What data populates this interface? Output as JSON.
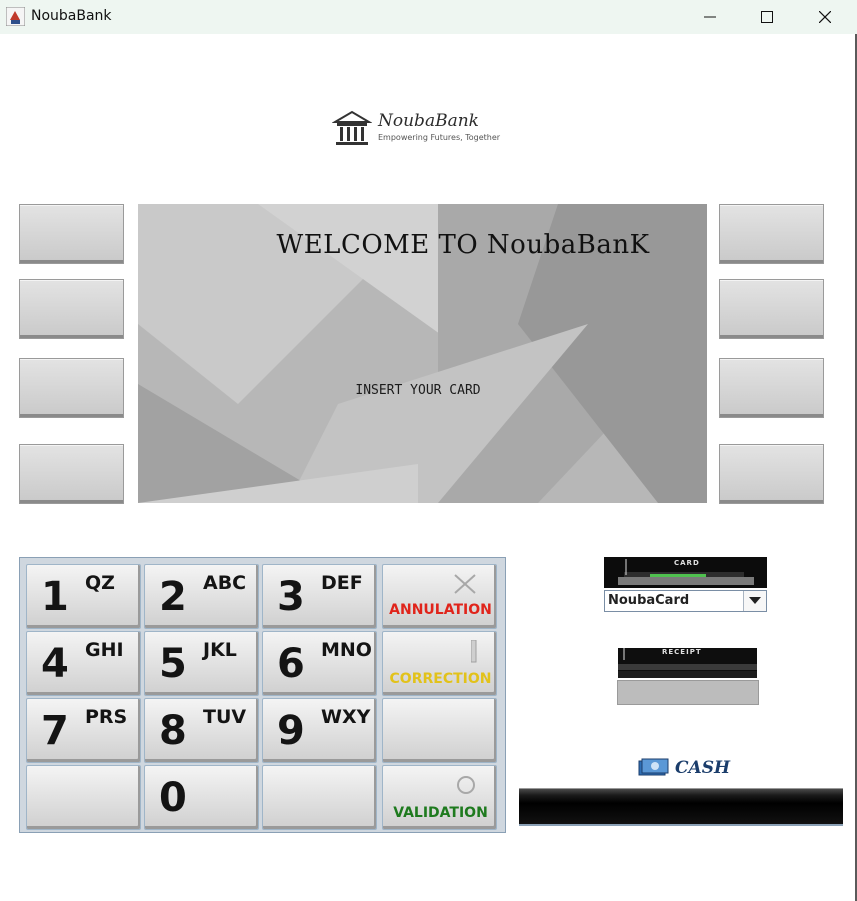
{
  "window": {
    "title": "NoubaBank",
    "app_icon": "java-cup-icon",
    "controls": [
      "minimize-icon",
      "maximize-icon",
      "close-icon"
    ]
  },
  "logo": {
    "brand": "NoubaBank",
    "tagline": "Empowering Futures, Together",
    "icon": "bank-building-icon"
  },
  "screen": {
    "welcome": "WELCOME TO NoubaBanK",
    "prompt": "INSERT YOUR CARD"
  },
  "side_buttons": {
    "left_count": 4,
    "right_count": 4
  },
  "keypad": {
    "keys": [
      {
        "digit": "1",
        "letters": "QZ"
      },
      {
        "digit": "2",
        "letters": "ABC"
      },
      {
        "digit": "3",
        "letters": "DEF"
      },
      {
        "function": "ANNULATION",
        "color": "#e0241b",
        "icon": "cancel-x-icon"
      },
      {
        "digit": "4",
        "letters": "GHI"
      },
      {
        "digit": "5",
        "letters": "JKL"
      },
      {
        "digit": "6",
        "letters": "MNO"
      },
      {
        "function": "CORRECTION",
        "color": "#e2c21a",
        "icon": "bar-icon"
      },
      {
        "digit": "7",
        "letters": "PRS"
      },
      {
        "digit": "8",
        "letters": "TUV"
      },
      {
        "digit": "9",
        "letters": "WXY"
      },
      {
        "function": "",
        "icon": ""
      },
      {
        "digit": "",
        "letters": ""
      },
      {
        "digit": "0",
        "letters": ""
      },
      {
        "digit": "",
        "letters": ""
      },
      {
        "function": "VALIDATION",
        "color": "#1e7a1e",
        "icon": "circle-icon"
      }
    ]
  },
  "card": {
    "slot_label": "CARD",
    "selected": "NoubaCard",
    "dropdown_icon": "chevron-down-icon"
  },
  "receipt": {
    "slot_label": "RECEIPT"
  },
  "cash": {
    "label": "CASH",
    "icon": "cash-bill-icon"
  }
}
